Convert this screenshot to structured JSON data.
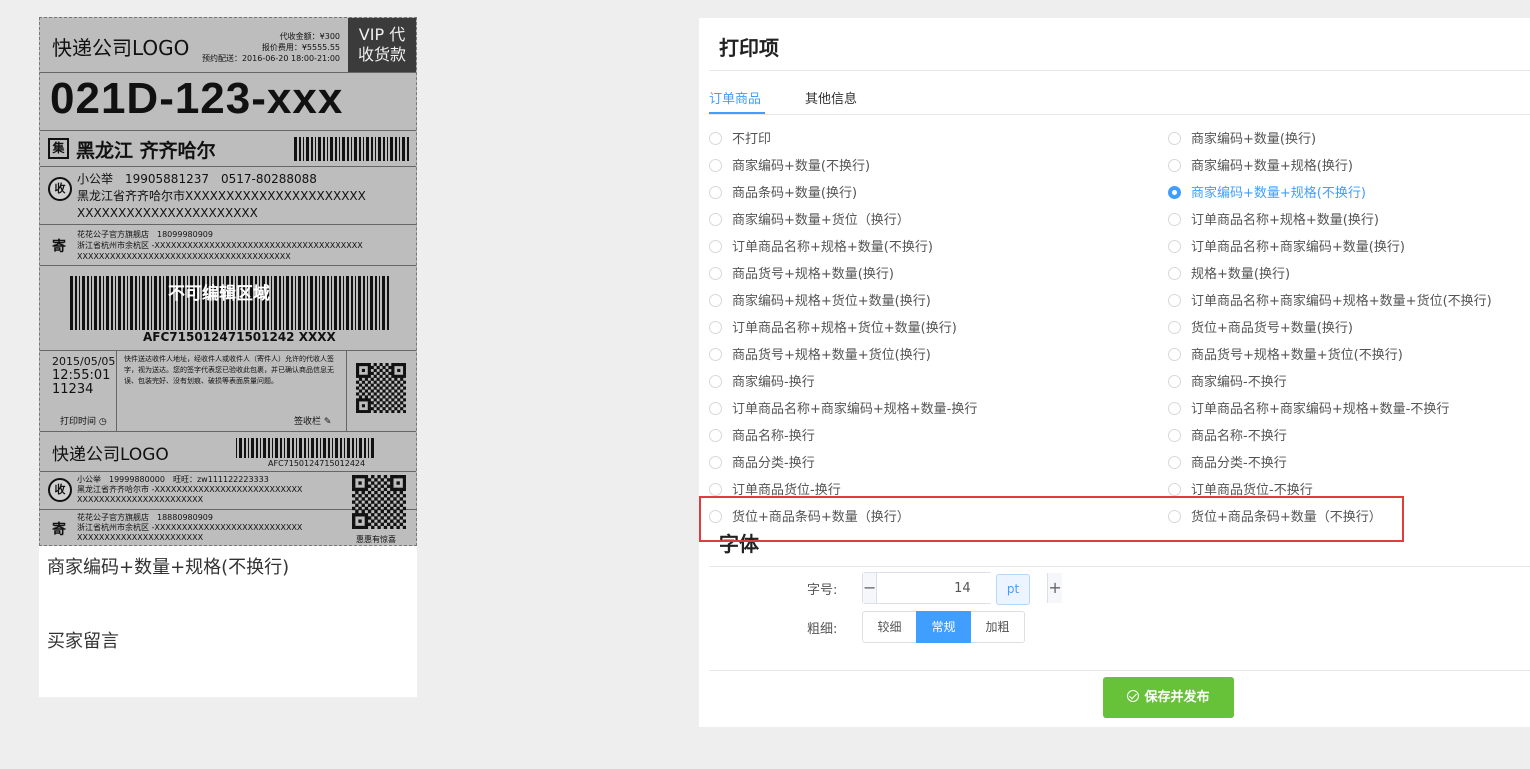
{
  "label_preview": {
    "logo": "快递公司LOGO",
    "head_info": [
      "代收金额：¥300",
      "报价费用：¥5555.55",
      "预约配送：2016-06-20 18:00-21:00"
    ],
    "vip": [
      "VIP 代",
      "收货款"
    ],
    "big_code": "021D-123-xxx",
    "region_icon": "集",
    "region": "黑龙江 齐齐哈尔",
    "recv_icon": "收",
    "recv_lines": [
      "小公举　19905881237　0517-80288088",
      "黑龙江省齐齐哈尔市XXXXXXXXXXXXXXXXXXXXXX",
      "XXXXXXXXXXXXXXXXXXXXXX"
    ],
    "send_icon": "寄",
    "send_lines": [
      "花花公子官方旗舰店　18099980909",
      "浙江省杭州市余杭区 -XXXXXXXXXXXXXXXXXXXXXXXXXXXXXXXXXXXXXX",
      "XXXXXXXXXXXXXXXXXXXXXXXXXXXXXXXXXXXXXXX"
    ],
    "overlay": "不可编辑区域",
    "barcode_number": "AFC715012471501242 XXXX",
    "date_lines": [
      "2015/05/05",
      "12:55:01",
      "11234"
    ],
    "print_time": "打印时间",
    "notice": "快件送达收件人地址，经收件人或收件人（寄件人）允许的代收人签字，视为送达。您的签字代表您已验收此包裹，并已确认商品信息无误、包装完好、没有划痕、破损等表面质量问题。",
    "sign": "签收栏",
    "logo2": "快递公司LOGO",
    "barcode_number2": "AFC7150124715012424",
    "recv2_lines": [
      "小公举　19999880000　旺旺：zw111122223333",
      "黑龙江省齐齐哈尔市 -XXXXXXXXXXXXXXXXXXXXXXXXXXX",
      "XXXXXXXXXXXXXXXXXXXXXXX"
    ],
    "send2_lines": [
      "花花公子官方旗舰店　18880980909",
      "浙江省杭州市余杭区 -XXXXXXXXXXXXXXXXXXXXXXXXXXX",
      "XXXXXXXXXXXXXXXXXXXXXXX"
    ],
    "qr_caption": "惠惠有惊喜",
    "field_1": "商家编码+数量+规格(不换行)",
    "field_2": "买家留言"
  },
  "panel": {
    "title": "打印项",
    "tabs": [
      {
        "label": "订单商品",
        "active": true
      },
      {
        "label": "其他信息",
        "active": false
      }
    ],
    "options_left": [
      "不打印",
      "商家编码+数量(不换行)",
      "商品条码+数量(换行)",
      "商家编码+数量+货位（换行）",
      "订单商品名称+规格+数量(不换行)",
      "商品货号+规格+数量(换行)",
      "商家编码+规格+货位+数量(换行)",
      "订单商品名称+规格+货位+数量(换行)",
      "商品货号+规格+数量+货位(换行)",
      "商家编码-换行",
      "订单商品名称+商家编码+规格+数量-换行",
      "商品名称-换行",
      "商品分类-换行",
      "订单商品货位-换行",
      "货位+商品条码+数量（换行）"
    ],
    "options_right": [
      "商家编码+数量(换行)",
      "商家编码+数量+规格(换行)",
      "商家编码+数量+规格(不换行)",
      "订单商品名称+规格+数量(换行)",
      "订单商品名称+商家编码+数量(换行)",
      "规格+数量(换行)",
      "订单商品名称+商家编码+规格+数量+货位(不换行)",
      "货位+商品货号+数量(换行)",
      "商品货号+规格+数量+货位(不换行)",
      "商家编码-不换行",
      "订单商品名称+商家编码+规格+数量-不换行",
      "商品名称-不换行",
      "商品分类-不换行",
      "订单商品货位-不换行",
      "货位+商品条码+数量（不换行）"
    ],
    "selected": "商家编码+数量+规格(不换行)",
    "font_section": "字体",
    "size_label": "字号:",
    "size_value": "14",
    "minus": "−",
    "plus": "+",
    "unit": "pt",
    "weight_label": "粗细:",
    "weights": [
      {
        "label": "较细",
        "active": false
      },
      {
        "label": "常规",
        "active": true
      },
      {
        "label": "加粗",
        "active": false
      }
    ],
    "save_label": "保存并发布",
    "colors": {
      "accent": "#409eff",
      "save": "#67c23a",
      "highlight": "#e03c3c"
    }
  }
}
